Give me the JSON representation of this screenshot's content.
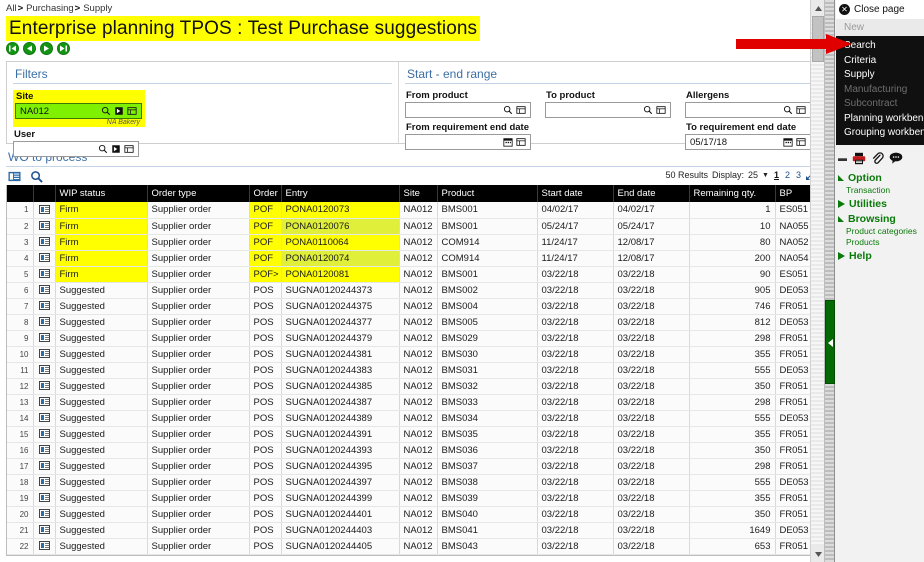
{
  "breadcrumb": [
    "All",
    "Purchasing",
    "Supply"
  ],
  "page_title": "Enterprise planning TPOS : Test Purchase suggestions",
  "nav_buttons": [
    {
      "name": "first",
      "glyph": "K"
    },
    {
      "name": "previous",
      "glyph": "<"
    },
    {
      "name": "next",
      "glyph": ">"
    },
    {
      "name": "last",
      "glyph": "N"
    }
  ],
  "filters": {
    "title": "Filters",
    "site_label": "Site",
    "site_value": "NA012",
    "site_sub": "NA Bakery",
    "user_label": "User",
    "user_value": ""
  },
  "range": {
    "title": "Start - end range",
    "from_product_label": "From product",
    "from_product_value": "",
    "to_product_label": "To product",
    "to_product_value": "",
    "allergens_label": "Allergens",
    "allergens_value": "",
    "from_req_end_date_label": "From requirement end date",
    "from_req_end_date_value": "",
    "to_req_end_date_label": "To requirement end date",
    "to_req_end_date_value": "05/17/18"
  },
  "wo": {
    "title": "WO to process",
    "results_count": "50 Results",
    "display_label": "Display:",
    "display_value": "25",
    "pages": [
      "1",
      "2",
      "3"
    ],
    "columns": [
      "",
      "",
      "WIP status",
      "Order type",
      "Order",
      "Entry",
      "Site",
      "Product",
      "Start date",
      "End date",
      "Remaining qty.",
      "BP"
    ],
    "rows": [
      {
        "n": "1",
        "wip": "Firm",
        "order_type": "Supplier order",
        "order": "POF",
        "entry": "PONA0120073",
        "site": "NA012",
        "product": "BMS001",
        "start": "04/02/17",
        "end": "04/02/17",
        "qty": "1",
        "bp": "ES051"
      },
      {
        "n": "2",
        "wip": "Firm",
        "order_type": "Supplier order",
        "order": "POF",
        "entry": "PONA0120076",
        "site": "NA012",
        "product": "BMS001",
        "start": "05/24/17",
        "end": "05/24/17",
        "qty": "10",
        "bp": "NA055"
      },
      {
        "n": "3",
        "wip": "Firm",
        "order_type": "Supplier order",
        "order": "POF",
        "entry": "PONA0110064",
        "site": "NA012",
        "product": "COM914",
        "start": "11/24/17",
        "end": "12/08/17",
        "qty": "80",
        "bp": "NA052"
      },
      {
        "n": "4",
        "wip": "Firm",
        "order_type": "Supplier order",
        "order": "POF",
        "entry": "PONA0120074",
        "site": "NA012",
        "product": "COM914",
        "start": "11/24/17",
        "end": "12/08/17",
        "qty": "200",
        "bp": "NA054"
      },
      {
        "n": "5",
        "wip": "Firm",
        "order_type": "Supplier order",
        "order": "POF>",
        "entry": "PONA0120081",
        "site": "NA012",
        "product": "BMS001",
        "start": "03/22/18",
        "end": "03/22/18",
        "qty": "90",
        "bp": "ES051"
      },
      {
        "n": "6",
        "wip": "Suggested",
        "order_type": "Supplier order",
        "order": "POS",
        "entry": "SUGNA0120244373",
        "site": "NA012",
        "product": "BMS002",
        "start": "03/22/18",
        "end": "03/22/18",
        "qty": "905",
        "bp": "DE053"
      },
      {
        "n": "7",
        "wip": "Suggested",
        "order_type": "Supplier order",
        "order": "POS",
        "entry": "SUGNA0120244375",
        "site": "NA012",
        "product": "BMS004",
        "start": "03/22/18",
        "end": "03/22/18",
        "qty": "746",
        "bp": "FR051"
      },
      {
        "n": "8",
        "wip": "Suggested",
        "order_type": "Supplier order",
        "order": "POS",
        "entry": "SUGNA0120244377",
        "site": "NA012",
        "product": "BMS005",
        "start": "03/22/18",
        "end": "03/22/18",
        "qty": "812",
        "bp": "DE053"
      },
      {
        "n": "9",
        "wip": "Suggested",
        "order_type": "Supplier order",
        "order": "POS",
        "entry": "SUGNA0120244379",
        "site": "NA012",
        "product": "BMS029",
        "start": "03/22/18",
        "end": "03/22/18",
        "qty": "298",
        "bp": "FR051"
      },
      {
        "n": "10",
        "wip": "Suggested",
        "order_type": "Supplier order",
        "order": "POS",
        "entry": "SUGNA0120244381",
        "site": "NA012",
        "product": "BMS030",
        "start": "03/22/18",
        "end": "03/22/18",
        "qty": "355",
        "bp": "FR051"
      },
      {
        "n": "11",
        "wip": "Suggested",
        "order_type": "Supplier order",
        "order": "POS",
        "entry": "SUGNA0120244383",
        "site": "NA012",
        "product": "BMS031",
        "start": "03/22/18",
        "end": "03/22/18",
        "qty": "555",
        "bp": "DE053"
      },
      {
        "n": "12",
        "wip": "Suggested",
        "order_type": "Supplier order",
        "order": "POS",
        "entry": "SUGNA0120244385",
        "site": "NA012",
        "product": "BMS032",
        "start": "03/22/18",
        "end": "03/22/18",
        "qty": "350",
        "bp": "FR051"
      },
      {
        "n": "13",
        "wip": "Suggested",
        "order_type": "Supplier order",
        "order": "POS",
        "entry": "SUGNA0120244387",
        "site": "NA012",
        "product": "BMS033",
        "start": "03/22/18",
        "end": "03/22/18",
        "qty": "298",
        "bp": "FR051"
      },
      {
        "n": "14",
        "wip": "Suggested",
        "order_type": "Supplier order",
        "order": "POS",
        "entry": "SUGNA0120244389",
        "site": "NA012",
        "product": "BMS034",
        "start": "03/22/18",
        "end": "03/22/18",
        "qty": "555",
        "bp": "DE053"
      },
      {
        "n": "15",
        "wip": "Suggested",
        "order_type": "Supplier order",
        "order": "POS",
        "entry": "SUGNA0120244391",
        "site": "NA012",
        "product": "BMS035",
        "start": "03/22/18",
        "end": "03/22/18",
        "qty": "355",
        "bp": "FR051"
      },
      {
        "n": "16",
        "wip": "Suggested",
        "order_type": "Supplier order",
        "order": "POS",
        "entry": "SUGNA0120244393",
        "site": "NA012",
        "product": "BMS036",
        "start": "03/22/18",
        "end": "03/22/18",
        "qty": "350",
        "bp": "FR051"
      },
      {
        "n": "17",
        "wip": "Suggested",
        "order_type": "Supplier order",
        "order": "POS",
        "entry": "SUGNA0120244395",
        "site": "NA012",
        "product": "BMS037",
        "start": "03/22/18",
        "end": "03/22/18",
        "qty": "298",
        "bp": "FR051"
      },
      {
        "n": "18",
        "wip": "Suggested",
        "order_type": "Supplier order",
        "order": "POS",
        "entry": "SUGNA0120244397",
        "site": "NA012",
        "product": "BMS038",
        "start": "03/22/18",
        "end": "03/22/18",
        "qty": "555",
        "bp": "DE053"
      },
      {
        "n": "19",
        "wip": "Suggested",
        "order_type": "Supplier order",
        "order": "POS",
        "entry": "SUGNA0120244399",
        "site": "NA012",
        "product": "BMS039",
        "start": "03/22/18",
        "end": "03/22/18",
        "qty": "355",
        "bp": "FR051"
      },
      {
        "n": "20",
        "wip": "Suggested",
        "order_type": "Supplier order",
        "order": "POS",
        "entry": "SUGNA0120244401",
        "site": "NA012",
        "product": "BMS040",
        "start": "03/22/18",
        "end": "03/22/18",
        "qty": "350",
        "bp": "FR051"
      },
      {
        "n": "21",
        "wip": "Suggested",
        "order_type": "Supplier order",
        "order": "POS",
        "entry": "SUGNA0120244403",
        "site": "NA012",
        "product": "BMS041",
        "start": "03/22/18",
        "end": "03/22/18",
        "qty": "1649",
        "bp": "DE053"
      },
      {
        "n": "22",
        "wip": "Suggested",
        "order_type": "Supplier order",
        "order": "POS",
        "entry": "SUGNA0120244405",
        "site": "NA012",
        "product": "BMS043",
        "start": "03/22/18",
        "end": "03/22/18",
        "qty": "653",
        "bp": "FR051"
      }
    ]
  },
  "right_panel": {
    "close_page": "Close page",
    "new": "New",
    "menu": [
      {
        "label": "Search",
        "disabled": false
      },
      {
        "label": "Criteria",
        "disabled": false
      },
      {
        "label": "Supply",
        "disabled": false
      },
      {
        "label": "Manufacturing",
        "disabled": true
      },
      {
        "label": "Subcontract",
        "disabled": true
      },
      {
        "label": "Planning workbench",
        "disabled": false
      },
      {
        "label": "Grouping workbench",
        "disabled": false
      }
    ],
    "icons": [
      "print-icon",
      "attachment-icon",
      "comment-icon"
    ],
    "groups": [
      {
        "name": "Option",
        "expanded": true,
        "items": [
          "Transaction"
        ]
      },
      {
        "name": "Utilities",
        "expanded": false,
        "items": []
      },
      {
        "name": "Browsing",
        "expanded": true,
        "items": [
          "Product categories",
          "Products"
        ]
      },
      {
        "name": "Help",
        "expanded": false,
        "items": []
      }
    ]
  },
  "colors": {
    "highlight": "#ffff00",
    "site_field": "#7ef000",
    "accent_blue": "#3c6fa5",
    "green": "#0a7a0a",
    "arrow_red": "#e00000"
  }
}
